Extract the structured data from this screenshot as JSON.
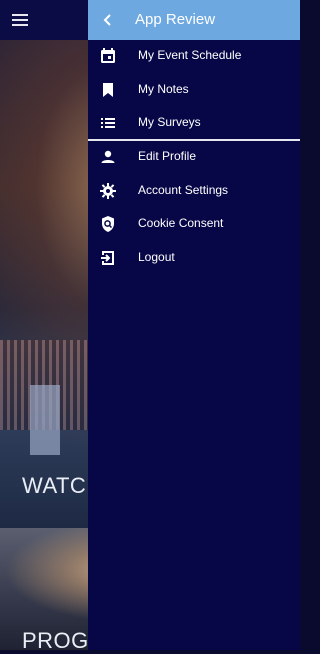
{
  "background": {
    "hero_title": "WATCH",
    "hero2_title": "PROGR"
  },
  "drawer": {
    "title": "App Review",
    "items_group1": [
      {
        "label": "My Event Schedule",
        "icon": "calendar-icon"
      },
      {
        "label": "My Notes",
        "icon": "bookmark-icon"
      },
      {
        "label": "My Surveys",
        "icon": "list-icon"
      }
    ],
    "items_group2": [
      {
        "label": "Edit Profile",
        "icon": "person-icon"
      },
      {
        "label": "Account Settings",
        "icon": "gear-icon"
      },
      {
        "label": "Cookie Consent",
        "icon": "shield-search-icon"
      },
      {
        "label": "Logout",
        "icon": "logout-icon"
      }
    ]
  },
  "colors": {
    "drawer_bg": "#070747",
    "header_bg": "#6ea8e0",
    "text": "#ffffff"
  }
}
